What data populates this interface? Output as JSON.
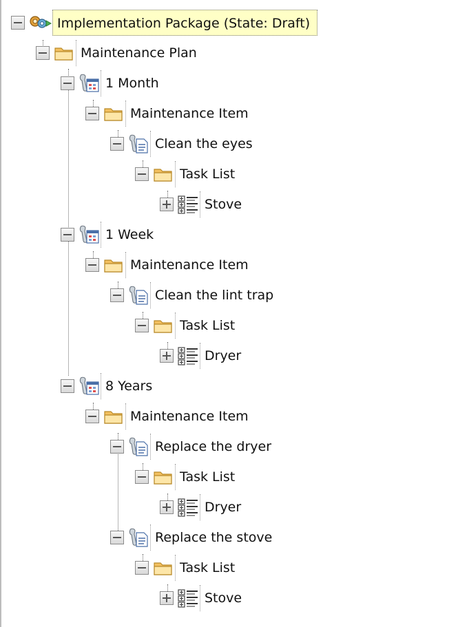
{
  "tree": {
    "root": {
      "label": "Implementation Package (State: Draft)",
      "icon": "package-gear-icon"
    },
    "maintenance_plan": {
      "label": "Maintenance Plan",
      "icon": "folder-icon"
    },
    "plans": [
      {
        "label": "1 Month",
        "icon": "wrench-calendar-icon",
        "item_folder": "Maintenance Item",
        "items": [
          {
            "label": "Clean the eyes",
            "icon": "wrench-document-icon",
            "task_folder": "Task List",
            "task": "Stove"
          }
        ]
      },
      {
        "label": "1 Week",
        "icon": "wrench-calendar-icon",
        "item_folder": "Maintenance Item",
        "items": [
          {
            "label": "Clean the lint trap",
            "icon": "wrench-document-icon",
            "task_folder": "Task List",
            "task": "Dryer"
          }
        ]
      },
      {
        "label": "8 Years",
        "icon": "wrench-calendar-icon",
        "item_folder": "Maintenance Item",
        "items": [
          {
            "label": "Replace the dryer",
            "icon": "wrench-document-icon",
            "task_folder": "Task List",
            "task": "Dryer"
          },
          {
            "label": "Replace the stove",
            "icon": "wrench-document-icon",
            "task_folder": "Task List",
            "task": "Stove"
          }
        ]
      }
    ]
  }
}
